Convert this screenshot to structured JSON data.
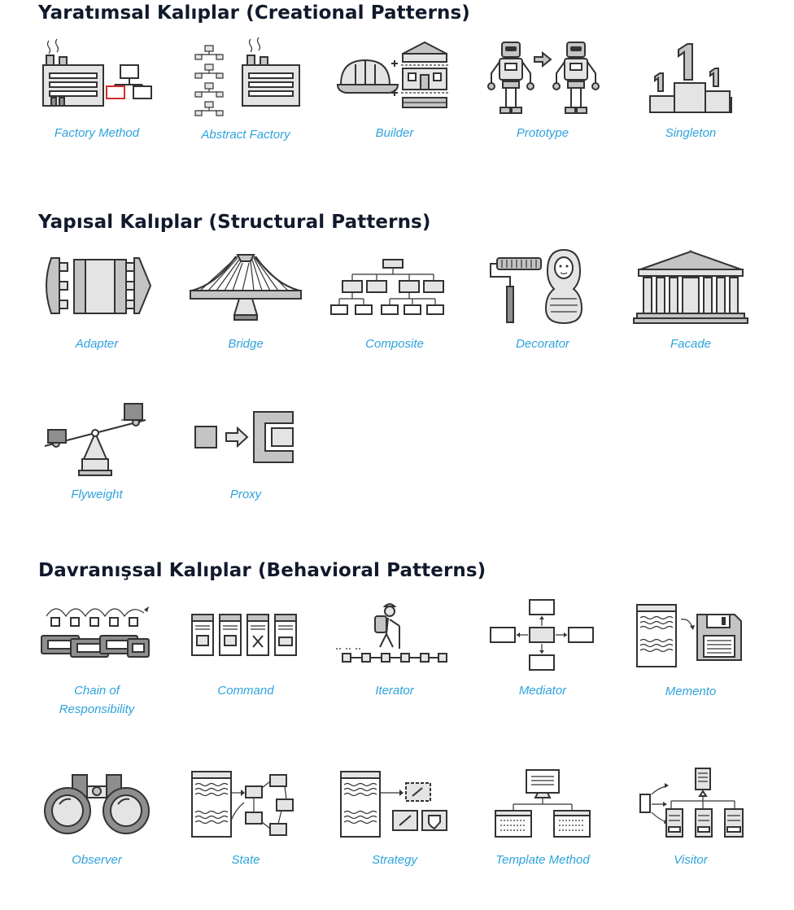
{
  "sections": {
    "creational": {
      "title": "Yaratımsal Kalıplar (Creational Patterns)",
      "items": [
        {
          "label": "Factory Method",
          "icon": "factory-icon"
        },
        {
          "label": "Abstract Factory",
          "icon": "abstract-factory-icon"
        },
        {
          "label": "Builder",
          "icon": "hardhat-house-icon"
        },
        {
          "label": "Prototype",
          "icon": "robot-clone-icon"
        },
        {
          "label": "Singleton",
          "icon": "podium-icon"
        }
      ]
    },
    "structural": {
      "title": "Yapısal Kalıplar (Structural Patterns)",
      "items": [
        {
          "label": "Adapter",
          "icon": "plug-adapter-icon"
        },
        {
          "label": "Bridge",
          "icon": "bridge-icon"
        },
        {
          "label": "Composite",
          "icon": "tree-hierarchy-icon"
        },
        {
          "label": "Decorator",
          "icon": "paint-roller-doll-icon"
        },
        {
          "label": "Facade",
          "icon": "temple-facade-icon"
        },
        {
          "label": "Flyweight",
          "icon": "seesaw-icon"
        },
        {
          "label": "Proxy",
          "icon": "proxy-box-icon"
        }
      ]
    },
    "behavioral": {
      "title": "Davranışsal Kalıplar (Behavioral Patterns)",
      "items": [
        {
          "label": "Chain of Responsibility",
          "icon": "chain-links-icon"
        },
        {
          "label": "Command",
          "icon": "command-cards-icon"
        },
        {
          "label": "Iterator",
          "icon": "hiker-path-icon"
        },
        {
          "label": "Mediator",
          "icon": "mediator-hub-icon"
        },
        {
          "label": "Memento",
          "icon": "floppy-disk-icon"
        },
        {
          "label": "Observer",
          "icon": "binoculars-icon"
        },
        {
          "label": "State",
          "icon": "state-machine-icon"
        },
        {
          "label": "Strategy",
          "icon": "strategy-tools-icon"
        },
        {
          "label": "Template Method",
          "icon": "monitor-template-icon"
        },
        {
          "label": "Visitor",
          "icon": "visitor-tree-icon"
        }
      ]
    }
  },
  "colors": {
    "heading": "#111a2c",
    "label": "#2ea3dc",
    "icon_stroke": "#333333",
    "icon_fill_light": "#e4e4e4",
    "icon_fill_mid": "#c4c4c4",
    "accent_red": "#d62b2b"
  }
}
